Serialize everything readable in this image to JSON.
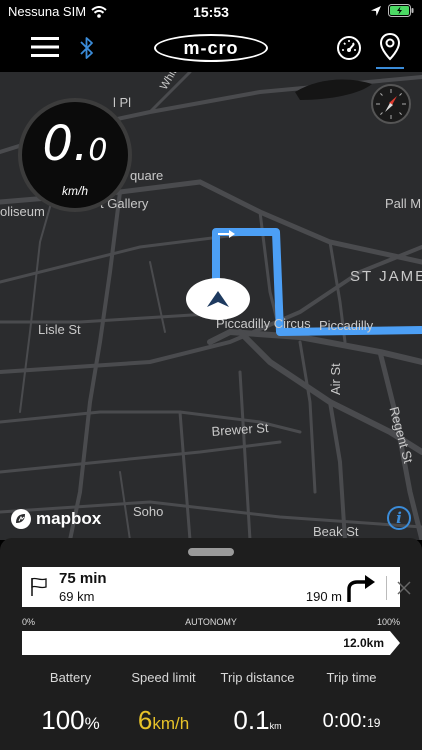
{
  "status_bar": {
    "carrier": "Nessuna SIM",
    "time": "15:53"
  },
  "nav": {
    "logo_text": "m-cro",
    "icons": [
      "menu-icon",
      "bluetooth-icon",
      "speedometer-icon",
      "location-pin-icon"
    ],
    "accent_color": "#3b8cd9"
  },
  "map": {
    "speed_value_int": "0.",
    "speed_value_dec": "0",
    "speed_unit": "km/h",
    "labels": {
      "pl": "l Pl",
      "whitehorse": "Whiteh",
      "square": "quare",
      "gallery": "t Gallery",
      "coliseum": "oliseum",
      "pall_mall": "Pall M",
      "st_james": "ST JAME",
      "lisle": "Lisle St",
      "piccadilly_circus": "Piccadilly Circus",
      "piccadilly": "Piccadilly",
      "air_st": "Air St",
      "regent_st": "Regent St",
      "brewer": "Brewer St",
      "soho": "Soho",
      "beak": "Beak St"
    },
    "attribution": "mapbox",
    "info_label": "i",
    "route_color": "#4c9ff5"
  },
  "panel": {
    "route": {
      "duration": "75 min",
      "distance": "69 km",
      "next_step_distance": "190 m"
    },
    "autonomy": {
      "label_min": "0%",
      "label_title": "AUTONOMY",
      "label_max": "100%",
      "value_text": "12.0km",
      "fill_percent": 100
    },
    "stats": {
      "battery": {
        "label": "Battery",
        "value": "100",
        "unit": "%"
      },
      "speed_limit": {
        "label": "Speed limit",
        "value": "6",
        "unit": "km/h"
      },
      "trip_distance": {
        "label": "Trip distance",
        "value": "0.1",
        "unit": "km"
      },
      "trip_time": {
        "label": "Trip time",
        "value": "0:00:",
        "unit": "19"
      }
    }
  }
}
